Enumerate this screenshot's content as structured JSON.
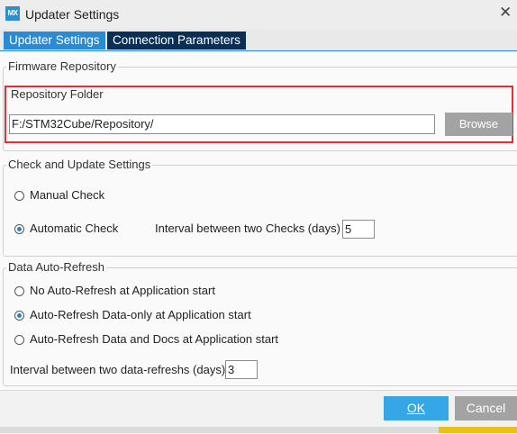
{
  "window": {
    "title": "Updater Settings",
    "app_icon_text": "MX"
  },
  "tabs": [
    {
      "label": "Updater Settings",
      "active": true
    },
    {
      "label": "Connection Parameters",
      "active": false
    }
  ],
  "firmware": {
    "legend": "Firmware Repository",
    "folder_label": "Repository Folder",
    "folder_value": "F:/STM32Cube/Repository/",
    "browse_label": "Browse"
  },
  "check": {
    "legend": "Check and Update Settings",
    "manual_label": "Manual Check",
    "auto_label": "Automatic Check",
    "selected": "Automatic Check",
    "interval_label": "Interval between two Checks (days)",
    "interval_value": "5"
  },
  "refresh": {
    "legend": "Data Auto-Refresh",
    "options": [
      "No Auto-Refresh at Application start",
      "Auto-Refresh Data-only at Application start",
      "Auto-Refresh Data and Docs at Application start"
    ],
    "selected": "Auto-Refresh Data-only at Application start",
    "interval_label": "Interval between two data-refreshs (days)",
    "interval_value": "3"
  },
  "footer": {
    "ok_label": "OK",
    "cancel_label": "Cancel"
  },
  "colors": {
    "accent": "#2a8ad4",
    "tab_dark": "#0a2f57",
    "highlight": "#e32f35",
    "ok": "#35a7e6"
  }
}
